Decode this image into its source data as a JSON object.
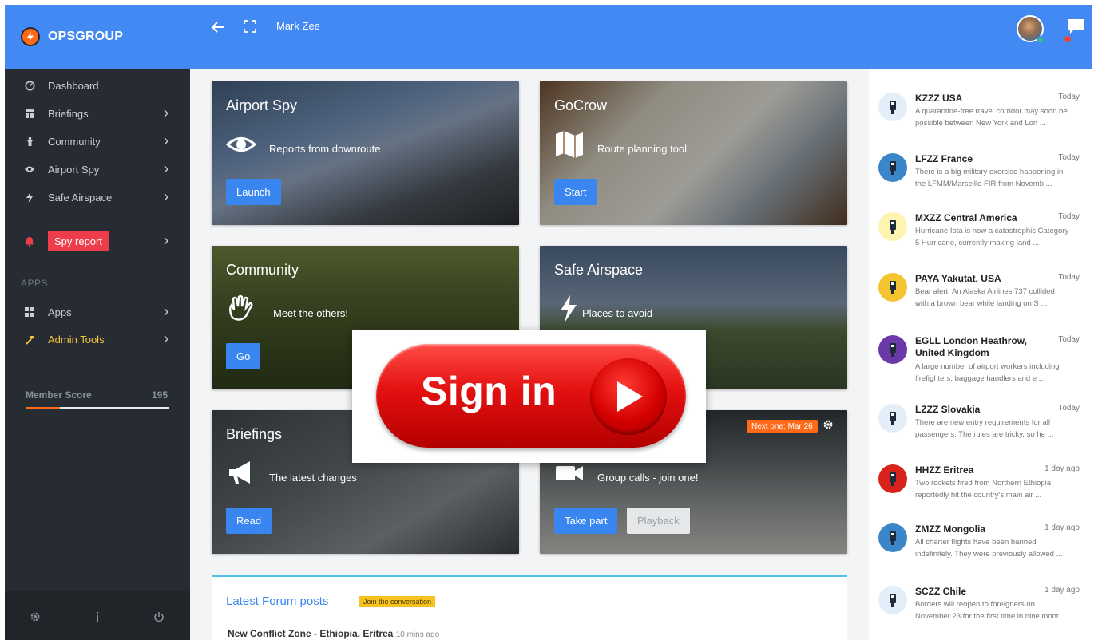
{
  "header": {
    "brand": "OPSGROUP",
    "user_name": "Mark Zee",
    "colors": {
      "primary": "#4289f4",
      "sidebar": "#262c31",
      "accent": "#ff6a1a"
    }
  },
  "sidebar": {
    "items": [
      {
        "label": "Dashboard",
        "icon": "dashboard-icon"
      },
      {
        "label": "Briefings",
        "icon": "briefings-icon"
      },
      {
        "label": "Community",
        "icon": "community-icon"
      },
      {
        "label": "Airport Spy",
        "icon": "eye-icon"
      },
      {
        "label": "Safe Airspace",
        "icon": "lightning-icon"
      }
    ],
    "spy_report": "Spy report",
    "apps_heading": "APPS",
    "apps_items": [
      {
        "label": "Apps",
        "icon": "grid-icon"
      },
      {
        "label": "Admin Tools",
        "icon": "hammer-icon"
      }
    ],
    "member_score": {
      "label": "Member Score",
      "value": "195",
      "progress": 0.24
    }
  },
  "cards": {
    "airport_spy": {
      "title": "Airport Spy",
      "subtitle": "Reports from downroute",
      "button": "Launch"
    },
    "gocrow": {
      "title": "GoCrow",
      "subtitle": "Route planning tool",
      "button": "Start"
    },
    "community": {
      "title": "Community",
      "subtitle": "Meet the others!",
      "button": "Go"
    },
    "safe_airspace": {
      "title": "Safe Airspace",
      "subtitle": "Places to avoid"
    },
    "briefings": {
      "title": "Briefings",
      "subtitle": "The latest changes",
      "button": "Read"
    },
    "group_calls": {
      "badge": "Next one: Mar 26",
      "subtitle": "Group calls - join one!",
      "button": "Take part",
      "button2": "Playback"
    }
  },
  "forum": {
    "title": "Latest Forum posts",
    "join": "Join the conversation",
    "post": "New Conflict Zone - Ethiopia, Eritrea",
    "post_time": "10 mins ago"
  },
  "signin": {
    "label": "Sign in"
  },
  "news": [
    {
      "title": "KZZZ USA",
      "time": "Today",
      "line1": "A quarantine-free travel corridor may soon be",
      "line2": "possible between New York and Lon ...",
      "icon": "procedure-icon",
      "icon_color": "#e3eef9"
    },
    {
      "title": "LFZZ France",
      "time": "Today",
      "line1": "There is a big military exercise happening in",
      "line2": "the LFMM/Marseille FIR from Novemb ...",
      "icon": "airspace-icon",
      "icon_color": "#3a86c8"
    },
    {
      "title": "MXZZ Central America",
      "time": "Today",
      "line1": "Hurricane Iota is now a catastrophic Category",
      "line2": "5 Hurricane, currently making land ...",
      "icon": "weather-icon",
      "icon_color": "#fff3b0"
    },
    {
      "title": "PAYA Yakutat, USA",
      "time": "Today",
      "line1": "Bear alert! An Alaska Airlines 737 collided",
      "line2": "with a brown bear while landing on S ...",
      "icon": "nature-icon",
      "icon_color": "#f4c430"
    },
    {
      "title": "EGLL London Heathrow, United Kingdom",
      "time": "Today",
      "line1": "A large number of airport workers including",
      "line2": "firefighters, baggage handlers and e ...",
      "icon": "strike-icon",
      "icon_color": "#6b3aa8"
    },
    {
      "title": "LZZZ Slovakia",
      "time": "Today",
      "line1": "There are new entry requirements for all",
      "line2": "passengers. The rules are tricky, so he ...",
      "icon": "procedure-icon",
      "icon_color": "#e3eef9"
    },
    {
      "title": "HHZZ Eritrea",
      "time": "1 day ago",
      "line1": "Two rockets fired from Northern Ethiopia",
      "line2": "reportedly hit the country's main air ...",
      "icon": "risk-icon",
      "icon_color": "#d8221c"
    },
    {
      "title": "ZMZZ Mongolia",
      "time": "1 day ago",
      "line1": "All charter flights have been banned",
      "line2": "indefinitely. They were previously allowed ...",
      "icon": "airspace-icon",
      "icon_color": "#3a86c8"
    },
    {
      "title": "SCZZ Chile",
      "time": "1 day ago",
      "line1": "Borders will reopen to foreigners on",
      "line2": "November 23 for the first time in nine mont ...",
      "icon": "procedure-icon",
      "icon_color": "#e3eef9"
    }
  ]
}
